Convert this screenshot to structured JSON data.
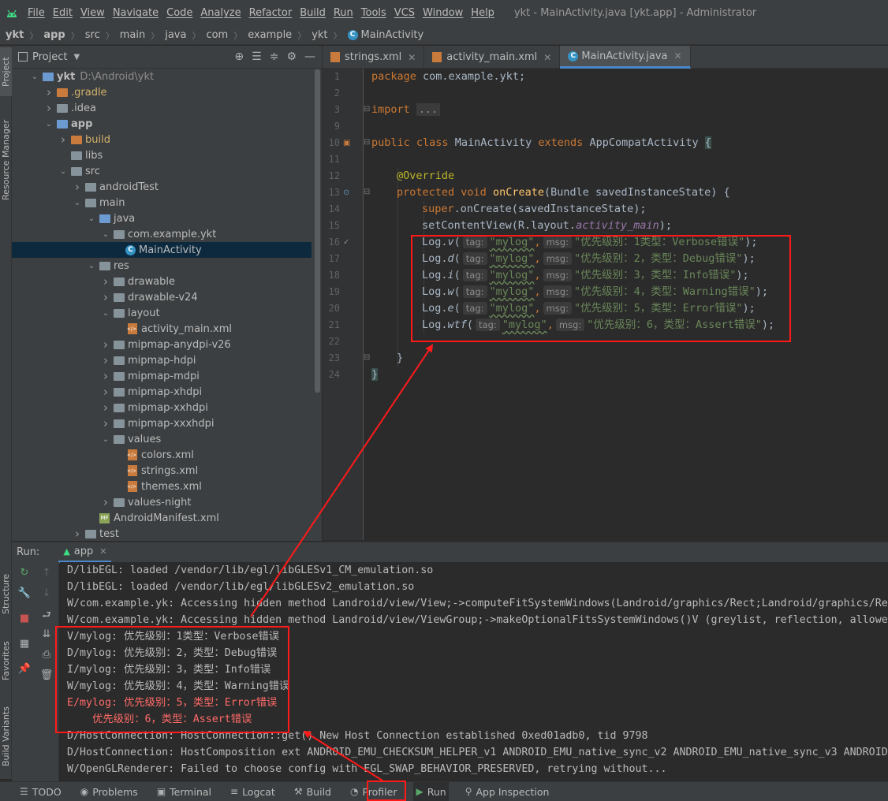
{
  "menubar": {
    "items": [
      "File",
      "Edit",
      "View",
      "Navigate",
      "Code",
      "Analyze",
      "Refactor",
      "Build",
      "Run",
      "Tools",
      "VCS",
      "Window",
      "Help"
    ],
    "window_title": "ykt - MainActivity.java [ykt.app] - Administrator"
  },
  "breadcrumb": [
    "ykt",
    "app",
    "src",
    "main",
    "java",
    "com",
    "example",
    "ykt",
    "MainActivity"
  ],
  "project": {
    "title": "Project",
    "tree": [
      {
        "label": "ykt",
        "path": "D:\\Android\\ykt",
        "depth": 0,
        "arrow": "down",
        "icon": "folder-blue",
        "bold": true
      },
      {
        "label": ".gradle",
        "depth": 1,
        "arrow": "right",
        "icon": "folder-orange"
      },
      {
        "label": ".idea",
        "depth": 1,
        "arrow": "right",
        "icon": "folder"
      },
      {
        "label": "app",
        "depth": 1,
        "arrow": "down",
        "icon": "folder-blue",
        "bold": true
      },
      {
        "label": "build",
        "depth": 2,
        "arrow": "right",
        "icon": "folder-orange"
      },
      {
        "label": "libs",
        "depth": 2,
        "arrow": "",
        "icon": "folder"
      },
      {
        "label": "src",
        "depth": 2,
        "arrow": "down",
        "icon": "folder"
      },
      {
        "label": "androidTest",
        "depth": 3,
        "arrow": "right",
        "icon": "folder"
      },
      {
        "label": "main",
        "depth": 3,
        "arrow": "down",
        "icon": "folder"
      },
      {
        "label": "java",
        "depth": 4,
        "arrow": "down",
        "icon": "folder-blue"
      },
      {
        "label": "com.example.ykt",
        "depth": 5,
        "arrow": "down",
        "icon": "folder"
      },
      {
        "label": "MainActivity",
        "depth": 6,
        "arrow": "",
        "icon": "class",
        "selected": true
      },
      {
        "label": "res",
        "depth": 4,
        "arrow": "down",
        "icon": "folder"
      },
      {
        "label": "drawable",
        "depth": 5,
        "arrow": "right",
        "icon": "folder"
      },
      {
        "label": "drawable-v24",
        "depth": 5,
        "arrow": "right",
        "icon": "folder"
      },
      {
        "label": "layout",
        "depth": 5,
        "arrow": "down",
        "icon": "folder"
      },
      {
        "label": "activity_main.xml",
        "depth": 6,
        "arrow": "",
        "icon": "xml"
      },
      {
        "label": "mipmap-anydpi-v26",
        "depth": 5,
        "arrow": "right",
        "icon": "folder"
      },
      {
        "label": "mipmap-hdpi",
        "depth": 5,
        "arrow": "right",
        "icon": "folder"
      },
      {
        "label": "mipmap-mdpi",
        "depth": 5,
        "arrow": "right",
        "icon": "folder"
      },
      {
        "label": "mipmap-xhdpi",
        "depth": 5,
        "arrow": "right",
        "icon": "folder"
      },
      {
        "label": "mipmap-xxhdpi",
        "depth": 5,
        "arrow": "right",
        "icon": "folder"
      },
      {
        "label": "mipmap-xxxhdpi",
        "depth": 5,
        "arrow": "right",
        "icon": "folder"
      },
      {
        "label": "values",
        "depth": 5,
        "arrow": "down",
        "icon": "folder"
      },
      {
        "label": "colors.xml",
        "depth": 6,
        "arrow": "",
        "icon": "xml"
      },
      {
        "label": "strings.xml",
        "depth": 6,
        "arrow": "",
        "icon": "xml"
      },
      {
        "label": "themes.xml",
        "depth": 6,
        "arrow": "",
        "icon": "xml"
      },
      {
        "label": "values-night",
        "depth": 5,
        "arrow": "right",
        "icon": "folder"
      },
      {
        "label": "AndroidManifest.xml",
        "depth": 4,
        "arrow": "",
        "icon": "manifest"
      },
      {
        "label": "test",
        "depth": 3,
        "arrow": "right",
        "icon": "folder"
      }
    ]
  },
  "left_strip": {
    "project": "Project",
    "resource_manager": "Resource Manager",
    "structure": "Structure",
    "favorites": "Favorites",
    "build_variants": "Build Variants"
  },
  "editor_tabs": [
    {
      "label": "strings.xml",
      "icon": "xml"
    },
    {
      "label": "activity_main.xml",
      "icon": "xml"
    },
    {
      "label": "MainActivity.java",
      "icon": "class",
      "active": true
    }
  ],
  "code": {
    "line_numbers": [
      "1",
      "2",
      "3",
      "9",
      "10",
      "11",
      "12",
      "13",
      "14",
      "15",
      "16",
      "17",
      "18",
      "19",
      "20",
      "21",
      "22",
      "23",
      "24"
    ],
    "package_kw": "package",
    "package_name": " com.example.ykt;",
    "import_kw": "import",
    "import_fold": "...",
    "class_line": {
      "public": "public",
      "class": "class",
      "name": "MainActivity",
      "extends": "extends",
      "super": "AppCompatActivity",
      "brace": "{"
    },
    "override": "@Override",
    "method_line": {
      "protected": "protected",
      "void": "void",
      "name": "onCreate",
      "params": "(Bundle savedInstanceState) {"
    },
    "super_call": {
      "super": "super",
      "rest": ".onCreate(savedInstanceState);"
    },
    "set_content": {
      "pre": "setContentView(R.layout.",
      "field": "activity_main",
      "post": ");"
    },
    "log_lines": [
      {
        "method": "Log.v(",
        "tag_hint": "tag:",
        "tag": "\"mylog\"",
        "msg_hint": "msg:",
        "msg": "\"优先级别：1类型：Verbose错误\"",
        "end": ");"
      },
      {
        "method": "Log.d(",
        "tag_hint": "tag:",
        "tag": "\"mylog\"",
        "msg_hint": "msg:",
        "msg": "\"优先级别：2，类型：Debug错误\"",
        "end": ");"
      },
      {
        "method": "Log.i(",
        "tag_hint": "tag:",
        "tag": "\"mylog\"",
        "msg_hint": "msg:",
        "msg": "\"优先级别：3，类型：Info错误\"",
        "end": ");"
      },
      {
        "method": "Log.w(",
        "tag_hint": "tag:",
        "tag": "\"mylog\"",
        "msg_hint": "msg:",
        "msg": "\"优先级别：4，类型：Warning错误\"",
        "end": ");"
      },
      {
        "method": "Log.e(",
        "tag_hint": "tag:",
        "tag": "\"mylog\"",
        "msg_hint": "msg:",
        "msg": "\"优先级别：5，类型：Error错误\"",
        "end": ");"
      },
      {
        "method": "Log.wtf(",
        "tag_hint": "tag:",
        "tag": "\"mylog\"",
        "msg_hint": "msg:",
        "msg": "\"优先级别：6，类型：Assert错误\"",
        "end": ");"
      }
    ],
    "close_method": "}",
    "close_class": "}"
  },
  "run": {
    "label": "Run:",
    "tab": "app",
    "console": [
      {
        "text": "D/libEGL: loaded /vendor/lib/egl/libGLESv1_CM_emulation.so",
        "level": "normal"
      },
      {
        "text": "D/libEGL: loaded /vendor/lib/egl/libGLESv2_emulation.so",
        "level": "normal"
      },
      {
        "text": "W/com.example.yk: Accessing hidden method Landroid/view/View;->computeFitSystemWindows(Landroid/graphics/Rect;Landroid/graphics/Re",
        "level": "normal"
      },
      {
        "text": "W/com.example.yk: Accessing hidden method Landroid/view/ViewGroup;->makeOptionalFitsSystemWindows()V (greylist, reflection, allowe",
        "level": "normal"
      },
      {
        "text": "V/mylog: 优先级别：1类型：Verbose错误",
        "level": "normal"
      },
      {
        "text": "D/mylog: 优先级别：2，类型：Debug错误",
        "level": "normal"
      },
      {
        "text": "I/mylog: 优先级别：3，类型：Info错误",
        "level": "normal"
      },
      {
        "text": "W/mylog: 优先级别：4，类型：Warning错误",
        "level": "normal"
      },
      {
        "text": "E/mylog: 优先级别：5，类型：Error错误",
        "level": "error"
      },
      {
        "text": "    优先级别：6，类型：Assert错误",
        "level": "error"
      },
      {
        "text": "D/HostConnection: HostConnection::get() New Host Connection established 0xed01adb0, tid 9798",
        "level": "normal"
      },
      {
        "text": "D/HostConnection: HostComposition ext ANDROID_EMU_CHECKSUM_HELPER_v1 ANDROID_EMU_native_sync_v2 ANDROID_EMU_native_sync_v3 ANDROID",
        "level": "normal"
      },
      {
        "text": "W/OpenGLRenderer: Failed to choose config with EGL_SWAP_BEHAVIOR_PRESERVED, retrying without...",
        "level": "normal"
      }
    ]
  },
  "bottom_bar": [
    {
      "label": "TODO",
      "icon": "list-icon"
    },
    {
      "label": "Problems",
      "icon": "problems-icon"
    },
    {
      "label": "Terminal",
      "icon": "terminal-icon"
    },
    {
      "label": "Logcat",
      "icon": "logcat-icon"
    },
    {
      "label": "Build",
      "icon": "hammer-icon"
    },
    {
      "label": "Profiler",
      "icon": "profiler-icon"
    },
    {
      "label": "Run",
      "icon": "play-icon",
      "active": true
    },
    {
      "label": "App Inspection",
      "icon": "inspection-icon"
    }
  ],
  "colors": {
    "annotation_red": "#ff1a1a",
    "error_text": "#ff6b68",
    "accent": "#4a88c7"
  }
}
